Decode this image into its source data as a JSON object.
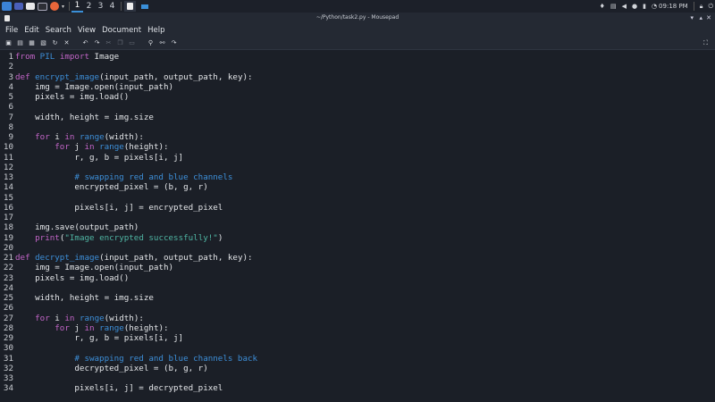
{
  "panel": {
    "workspaces": [
      "1",
      "2",
      "3",
      "4"
    ],
    "active_workspace": "1",
    "clock": "09:18 PM",
    "icons": [
      "kali-menu-icon",
      "desktop-icon",
      "files-icon",
      "terminal-icon",
      "firefox-icon",
      "chevron-down-icon",
      "mousepad-icon",
      "window-icon",
      "bluetooth-icon",
      "network-icon",
      "volume-icon",
      "notifications-icon",
      "battery-icon",
      "clock-icon",
      "lock-icon",
      "power-icon"
    ],
    "colors": {
      "bg": "#1c2029",
      "accent": "#3a8fd8"
    }
  },
  "window": {
    "title": "~/Python/task2.py - Mousepad"
  },
  "menu": [
    "File",
    "Edit",
    "Search",
    "View",
    "Document",
    "Help"
  ],
  "toolbar": {
    "items": [
      "new-file-icon",
      "open-icon",
      "save-icon",
      "save-as-icon",
      "reload-icon",
      "close-icon",
      "undo-icon",
      "redo-icon",
      "cut-icon",
      "copy-icon",
      "paste-icon",
      "search-icon",
      "find-replace-icon",
      "go-to-line-icon"
    ],
    "fullscreen": "fullscreen-icon"
  },
  "editor": {
    "colors": {
      "bg": "#1b1f27",
      "keyword": "#c265c7",
      "function": "#3d8fd9",
      "comment": "#3d8fd9",
      "string": "#4fb5a3"
    },
    "lines": [
      [
        {
          "t": "from ",
          "c": "kw"
        },
        {
          "t": "PIL ",
          "c": "fn"
        },
        {
          "t": "import ",
          "c": "kw"
        },
        {
          "t": "Image",
          "c": ""
        }
      ],
      [],
      [
        {
          "t": "def ",
          "c": "kw"
        },
        {
          "t": "encrypt_image",
          "c": "fn"
        },
        {
          "t": "(input_path, output_path, key):",
          "c": ""
        }
      ],
      [
        {
          "t": "    img = Image.open(input_path)",
          "c": ""
        }
      ],
      [
        {
          "t": "    pixels = img.load()",
          "c": ""
        }
      ],
      [],
      [
        {
          "t": "    width, height = img.size",
          "c": ""
        }
      ],
      [],
      [
        {
          "t": "    ",
          "c": ""
        },
        {
          "t": "for ",
          "c": "kw"
        },
        {
          "t": "i ",
          "c": ""
        },
        {
          "t": "in ",
          "c": "kw"
        },
        {
          "t": "range",
          "c": "fn"
        },
        {
          "t": "(width):",
          "c": ""
        }
      ],
      [
        {
          "t": "        ",
          "c": ""
        },
        {
          "t": "for ",
          "c": "kw"
        },
        {
          "t": "j ",
          "c": ""
        },
        {
          "t": "in ",
          "c": "kw"
        },
        {
          "t": "range",
          "c": "fn"
        },
        {
          "t": "(height):",
          "c": ""
        }
      ],
      [
        {
          "t": "            r, g, b = pixels[i, j]",
          "c": ""
        }
      ],
      [],
      [
        {
          "t": "            ",
          "c": ""
        },
        {
          "t": "# swapping red and blue channels",
          "c": "cm"
        }
      ],
      [
        {
          "t": "            encrypted_pixel = (b, g, r)",
          "c": ""
        }
      ],
      [],
      [
        {
          "t": "            pixels[i, j] = encrypted_pixel",
          "c": ""
        }
      ],
      [],
      [
        {
          "t": "    img.save(output_path)",
          "c": ""
        }
      ],
      [
        {
          "t": "    ",
          "c": ""
        },
        {
          "t": "print",
          "c": "bi"
        },
        {
          "t": "(",
          "c": ""
        },
        {
          "t": "\"Image encrypted successfully!\"",
          "c": "str"
        },
        {
          "t": ")",
          "c": ""
        }
      ],
      [],
      [
        {
          "t": "def ",
          "c": "kw"
        },
        {
          "t": "decrypt_image",
          "c": "fn"
        },
        {
          "t": "(input_path, output_path, key):",
          "c": ""
        }
      ],
      [
        {
          "t": "    img = Image.open(input_path)",
          "c": ""
        }
      ],
      [
        {
          "t": "    pixels = img.load()",
          "c": ""
        }
      ],
      [],
      [
        {
          "t": "    width, height = img.size",
          "c": ""
        }
      ],
      [],
      [
        {
          "t": "    ",
          "c": ""
        },
        {
          "t": "for ",
          "c": "kw"
        },
        {
          "t": "i ",
          "c": ""
        },
        {
          "t": "in ",
          "c": "kw"
        },
        {
          "t": "range",
          "c": "fn"
        },
        {
          "t": "(width):",
          "c": ""
        }
      ],
      [
        {
          "t": "        ",
          "c": ""
        },
        {
          "t": "for ",
          "c": "kw"
        },
        {
          "t": "j ",
          "c": ""
        },
        {
          "t": "in ",
          "c": "kw"
        },
        {
          "t": "range",
          "c": "fn"
        },
        {
          "t": "(height):",
          "c": ""
        }
      ],
      [
        {
          "t": "            r, g, b = pixels[i, j]",
          "c": ""
        }
      ],
      [],
      [
        {
          "t": "            ",
          "c": ""
        },
        {
          "t": "# swapping red and blue channels back",
          "c": "cm"
        }
      ],
      [
        {
          "t": "            decrypted_pixel = (b, g, r)",
          "c": ""
        }
      ],
      [],
      [
        {
          "t": "            pixels[i, j] = decrypted_pixel",
          "c": ""
        }
      ]
    ]
  }
}
